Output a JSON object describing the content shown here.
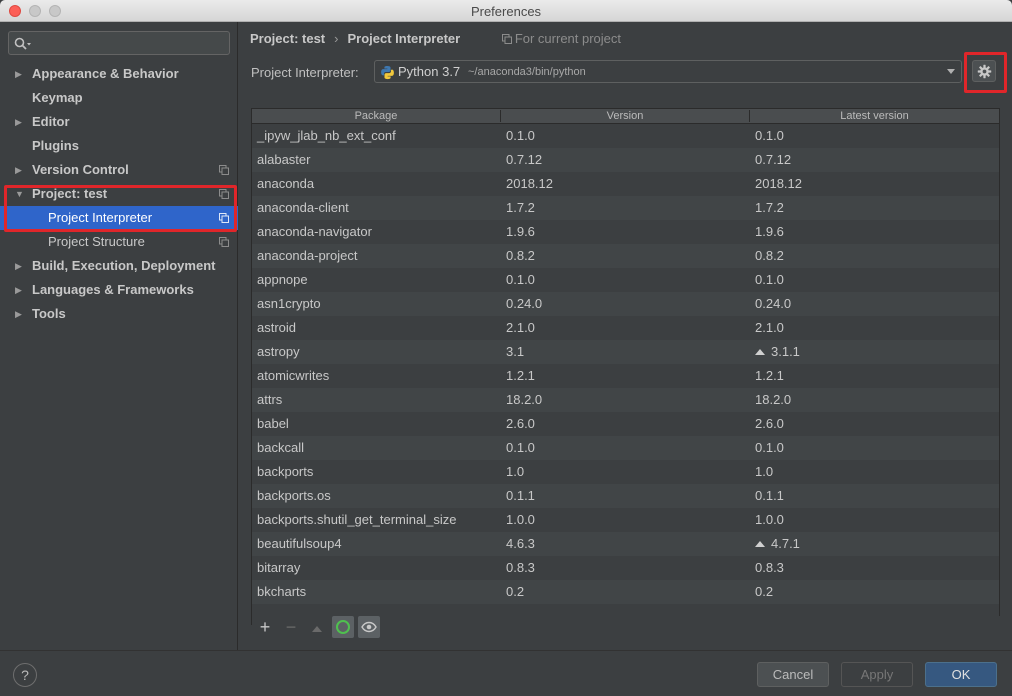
{
  "window": {
    "title": "Preferences"
  },
  "sidebar": {
    "search_placeholder": "",
    "items": [
      {
        "label": "Appearance & Behavior",
        "arrow": "▶"
      },
      {
        "label": "Keymap",
        "arrow": ""
      },
      {
        "label": "Editor",
        "arrow": "▶"
      },
      {
        "label": "Plugins",
        "arrow": ""
      },
      {
        "label": "Version Control",
        "arrow": "▶"
      },
      {
        "label": "Project: test",
        "arrow": "▼"
      },
      {
        "label": "Project Interpreter",
        "arrow": ""
      },
      {
        "label": "Project Structure",
        "arrow": ""
      },
      {
        "label": "Build, Execution, Deployment",
        "arrow": "▶"
      },
      {
        "label": "Languages & Frameworks",
        "arrow": "▶"
      },
      {
        "label": "Tools",
        "arrow": "▶"
      }
    ]
  },
  "breadcrumb": {
    "project": "Project: test",
    "separator": "›",
    "page": "Project Interpreter",
    "scope": "For current project"
  },
  "interpreter": {
    "label": "Project Interpreter:",
    "name": "Python 3.7",
    "path": "~/anaconda3/bin/python"
  },
  "table": {
    "headers": [
      "Package",
      "Version",
      "Latest version"
    ],
    "rows": [
      {
        "package": "_ipyw_jlab_nb_ext_conf",
        "version": "0.1.0",
        "latest": "0.1.0",
        "upgrade": false
      },
      {
        "package": "alabaster",
        "version": "0.7.12",
        "latest": "0.7.12",
        "upgrade": false
      },
      {
        "package": "anaconda",
        "version": "2018.12",
        "latest": "2018.12",
        "upgrade": false
      },
      {
        "package": "anaconda-client",
        "version": "1.7.2",
        "latest": "1.7.2",
        "upgrade": false
      },
      {
        "package": "anaconda-navigator",
        "version": "1.9.6",
        "latest": "1.9.6",
        "upgrade": false
      },
      {
        "package": "anaconda-project",
        "version": "0.8.2",
        "latest": "0.8.2",
        "upgrade": false
      },
      {
        "package": "appnope",
        "version": "0.1.0",
        "latest": "0.1.0",
        "upgrade": false
      },
      {
        "package": "asn1crypto",
        "version": "0.24.0",
        "latest": "0.24.0",
        "upgrade": false
      },
      {
        "package": "astroid",
        "version": "2.1.0",
        "latest": "2.1.0",
        "upgrade": false
      },
      {
        "package": "astropy",
        "version": "3.1",
        "latest": "3.1.1",
        "upgrade": true
      },
      {
        "package": "atomicwrites",
        "version": "1.2.1",
        "latest": "1.2.1",
        "upgrade": false
      },
      {
        "package": "attrs",
        "version": "18.2.0",
        "latest": "18.2.0",
        "upgrade": false
      },
      {
        "package": "babel",
        "version": "2.6.0",
        "latest": "2.6.0",
        "upgrade": false
      },
      {
        "package": "backcall",
        "version": "0.1.0",
        "latest": "0.1.0",
        "upgrade": false
      },
      {
        "package": "backports",
        "version": "1.0",
        "latest": "1.0",
        "upgrade": false
      },
      {
        "package": "backports.os",
        "version": "0.1.1",
        "latest": "0.1.1",
        "upgrade": false
      },
      {
        "package": "backports.shutil_get_terminal_size",
        "version": "1.0.0",
        "latest": "1.0.0",
        "upgrade": false
      },
      {
        "package": "beautifulsoup4",
        "version": "4.6.3",
        "latest": "4.7.1",
        "upgrade": true
      },
      {
        "package": "bitarray",
        "version": "0.8.3",
        "latest": "0.8.3",
        "upgrade": false
      },
      {
        "package": "bkcharts",
        "version": "0.2",
        "latest": "0.2",
        "upgrade": false
      }
    ]
  },
  "toolbar": {
    "add": "+",
    "remove": "−"
  },
  "footer": {
    "help": "?",
    "cancel": "Cancel",
    "apply": "Apply",
    "ok": "OK"
  },
  "colors": {
    "selection": "#2f65ca",
    "highlight_box": "#e0262a",
    "ok_button": "#365880"
  }
}
